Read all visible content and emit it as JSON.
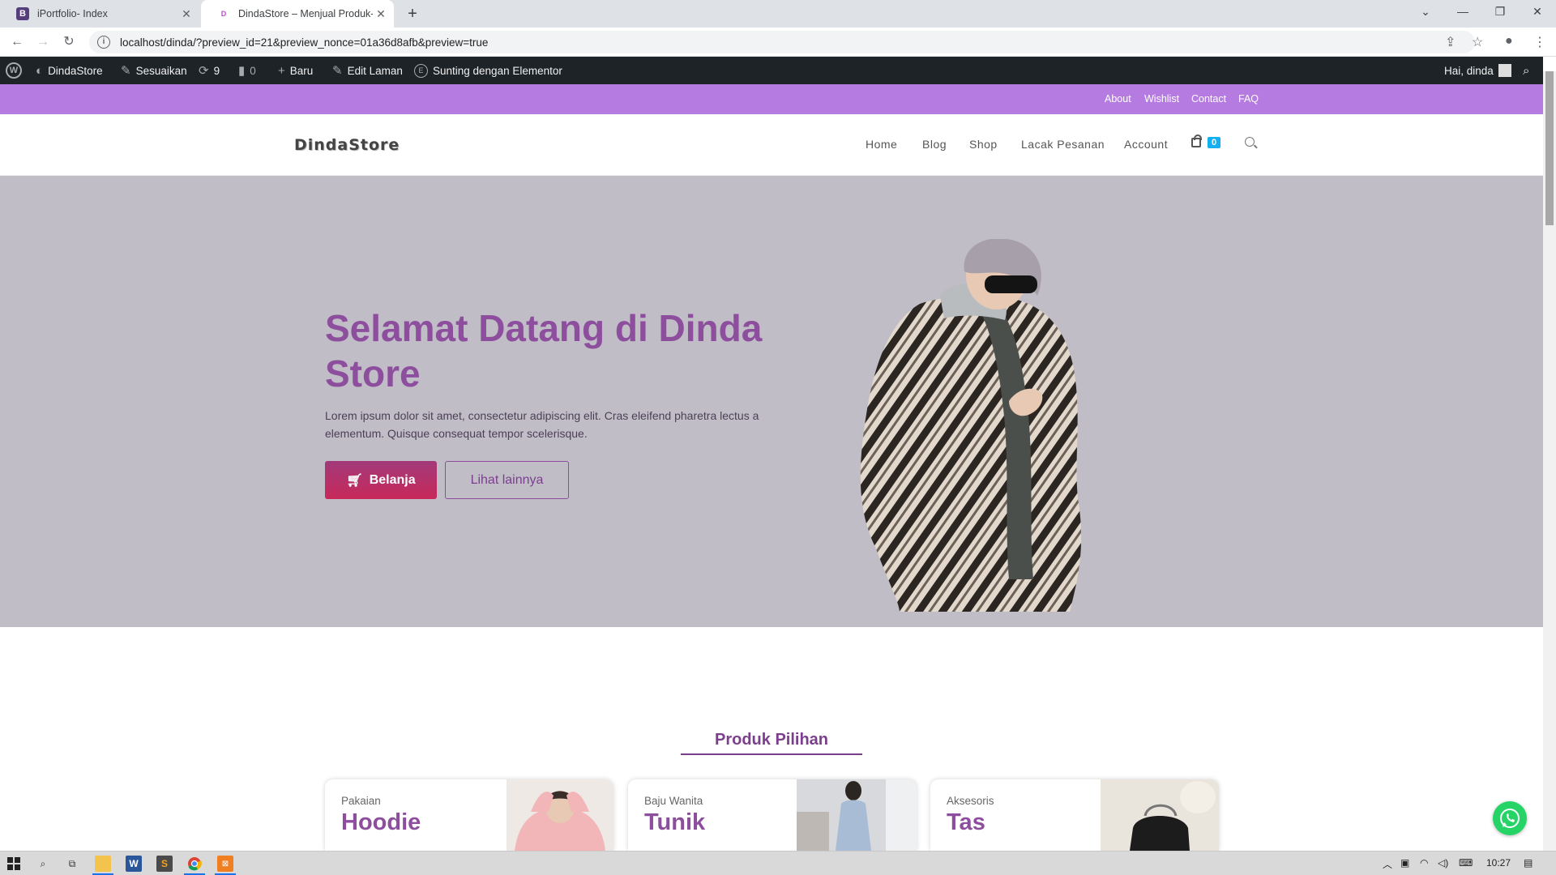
{
  "browser": {
    "tabs": [
      {
        "favicon": "B",
        "title": "iPortfolio- Index",
        "active": false
      },
      {
        "favicon": "D",
        "title": "DindaStore – Menjual Produk-Pr",
        "active": true
      }
    ],
    "new_tab": "+",
    "url": "localhost/dinda/?preview_id=21&preview_nonce=01a36d8afb&preview=true"
  },
  "wp_admin": {
    "site": "DindaStore",
    "customize": "Sesuaikan",
    "updates": "9",
    "comments": "0",
    "new": "Baru",
    "edit": "Edit Laman",
    "elementor": "Sunting dengan Elementor",
    "greeting": "Hai, dinda"
  },
  "topbar": {
    "links": [
      "About",
      "Wishlist",
      "Contact",
      "FAQ"
    ]
  },
  "header": {
    "logo": "DindaStore",
    "menu": [
      "Home",
      "Blog",
      "Shop",
      "Lacak Pesanan",
      "Account"
    ],
    "cart_count": "0"
  },
  "hero": {
    "title": "Selamat Datang di Dinda Store",
    "text": "Lorem ipsum dolor sit amet, consectetur adipiscing elit. Cras eleifend pharetra lectus a elementum. Quisque consequat tempor scelerisque.",
    "primary_button": "Belanja",
    "secondary_button": "Lihat lainnya"
  },
  "featured": {
    "title": "Produk Pilihan",
    "cards": [
      {
        "category": "Pakaian",
        "name": "Hoodie"
      },
      {
        "category": "Baju Wanita",
        "name": "Tunik"
      },
      {
        "category": "Aksesoris",
        "name": "Tas"
      }
    ]
  },
  "taskbar": {
    "time": "10:27"
  },
  "colors": {
    "accent_purple": "#8d4e9e",
    "topbar": "#b57be0",
    "hero_bg": "#c1bdc7",
    "cart_badge": "#13aff0",
    "whatsapp": "#25d366"
  }
}
